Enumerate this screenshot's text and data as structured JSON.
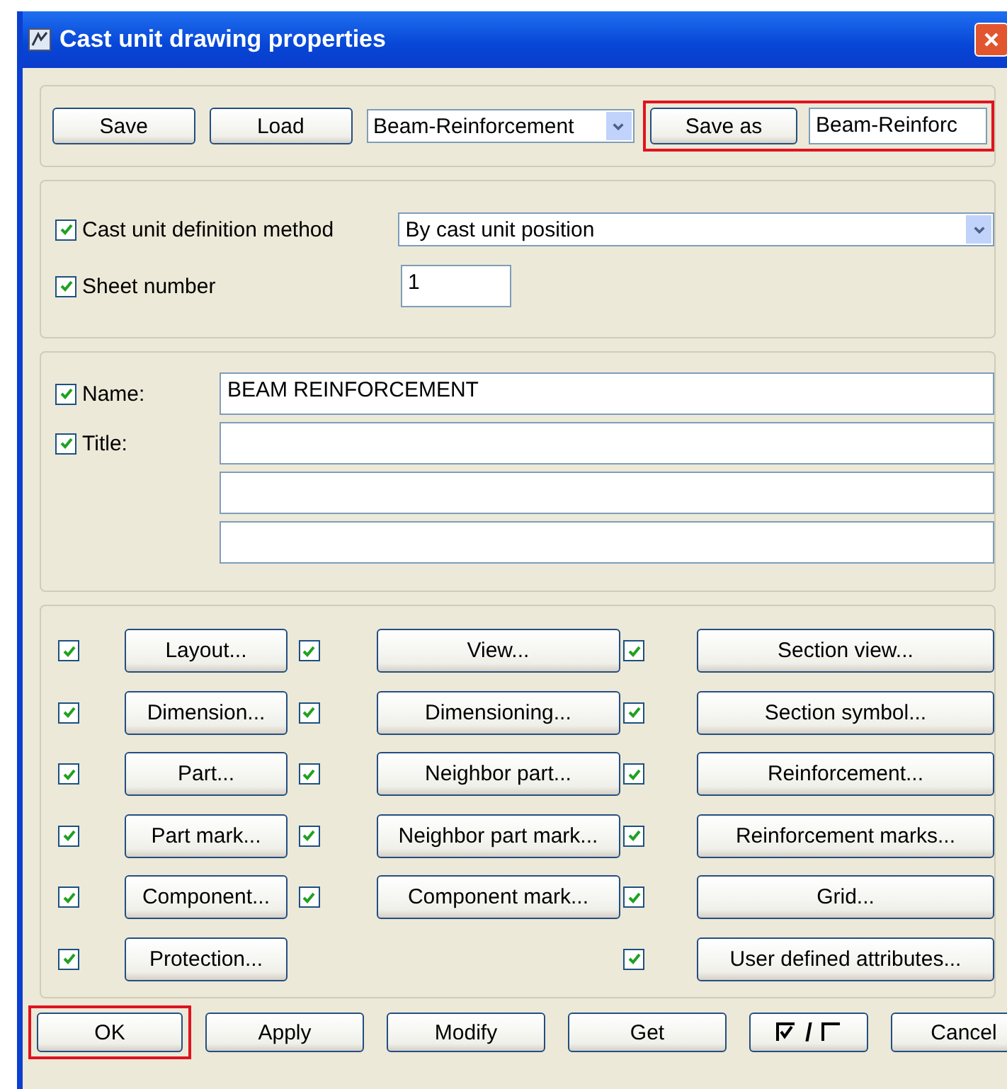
{
  "window": {
    "title": "Cast unit drawing properties"
  },
  "file_bar": {
    "save": "Save",
    "load": "Load",
    "preset": "Beam-Reinforcement",
    "save_as": {
      "label": "Save as",
      "value": "Beam-Reinforc",
      "highlighted": true
    }
  },
  "definition": [
    {
      "kind": "dropdown",
      "label": "Cast unit definition method",
      "checked": true,
      "value": "By cast unit position"
    },
    {
      "kind": "text",
      "label": "Sheet number",
      "checked": true,
      "value": "1"
    }
  ],
  "names": [
    {
      "label": "Name:",
      "checked": true,
      "fields": [
        {
          "kind": "filled",
          "value": "BEAM REINFORCEMENT"
        }
      ]
    },
    {
      "label": "Title:",
      "checked": true,
      "fields": [
        {
          "kind": "blank"
        },
        {
          "kind": "blank"
        },
        {
          "kind": "blank"
        }
      ]
    }
  ],
  "option_columns": [
    [
      {
        "label": "Layout...",
        "checked": true
      },
      {
        "label": "Dimension...",
        "checked": true
      },
      {
        "label": "Part...",
        "checked": true
      },
      {
        "label": "Part mark...",
        "checked": true
      },
      {
        "label": "Component...",
        "checked": true
      },
      {
        "label": "Protection...",
        "checked": true
      }
    ],
    [
      {
        "label": "View...",
        "checked": true
      },
      {
        "label": "Dimensioning...",
        "checked": true
      },
      {
        "label": "Neighbor part...",
        "checked": true
      },
      {
        "label": "Neighbor part mark...",
        "checked": true
      },
      {
        "label": "Component mark...",
        "checked": true
      }
    ],
    [
      {
        "label": "Section view...",
        "checked": true
      },
      {
        "label": "Section symbol...",
        "checked": true
      },
      {
        "label": "Reinforcement...",
        "checked": true
      },
      {
        "label": "Reinforcement marks...",
        "checked": true
      },
      {
        "label": "Grid...",
        "checked": true
      },
      {
        "label": "User defined attributes...",
        "checked": true
      }
    ]
  ],
  "buttons": [
    {
      "kind": "text",
      "label": "OK",
      "highlighted": true
    },
    {
      "kind": "text",
      "label": "Apply",
      "highlighted": false
    },
    {
      "kind": "text",
      "label": "Modify",
      "highlighted": false
    },
    {
      "kind": "text",
      "label": "Get",
      "highlighted": false
    },
    {
      "kind": "toggle",
      "label": "/",
      "highlighted": false
    },
    {
      "kind": "text",
      "label": "Cancel",
      "highlighted": false
    }
  ]
}
